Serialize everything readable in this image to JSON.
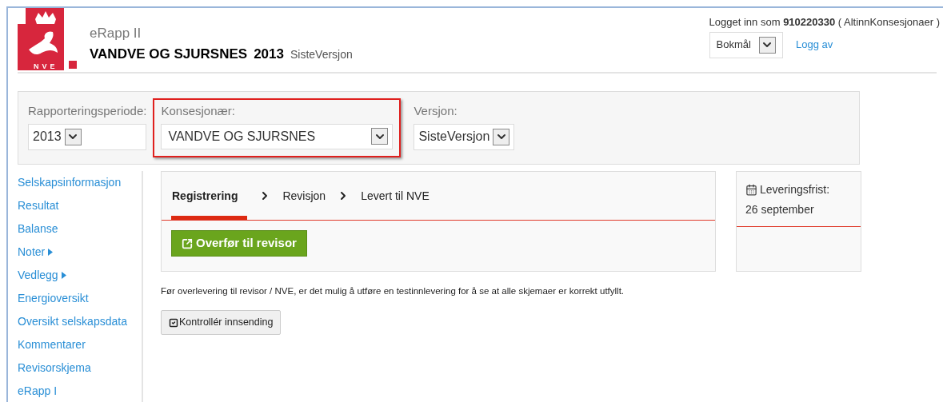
{
  "header": {
    "logo_text": "NVE",
    "app_name": "eRapp II",
    "company": "VANDVE OG SJURSNES",
    "year": "2013",
    "version": "SisteVersjon"
  },
  "user": {
    "prefix": "Logget inn som",
    "id": "910220330",
    "role": "( AltinnKonsesjonaer )",
    "language": "Bokmål",
    "logout": "Logg av"
  },
  "filters": [
    {
      "label": "Rapporteringsperiode:",
      "value": "2013",
      "highlighted": false
    },
    {
      "label": "Konsesjonær:",
      "value": "VANDVE OG SJURSNES",
      "highlighted": true
    },
    {
      "label": "Versjon:",
      "value": "SisteVersjon",
      "highlighted": false
    }
  ],
  "sidebar": {
    "items": [
      {
        "label": "Selskapsinformasjon",
        "expandable": false
      },
      {
        "label": "Resultat",
        "expandable": false
      },
      {
        "label": "Balanse",
        "expandable": false
      },
      {
        "label": "Noter",
        "expandable": true
      },
      {
        "label": "Vedlegg",
        "expandable": true
      },
      {
        "label": "Energioversikt",
        "expandable": false
      },
      {
        "label": "Oversikt selskapsdata",
        "expandable": false
      },
      {
        "label": "Kommentarer",
        "expandable": false
      },
      {
        "label": "Revisorskjema",
        "expandable": false
      },
      {
        "label": "eRapp I",
        "expandable": false
      }
    ]
  },
  "steps": [
    {
      "label": "Registrering",
      "selected": true
    },
    {
      "label": "Revisjon",
      "selected": false
    },
    {
      "label": "Levert til NVE",
      "selected": false
    }
  ],
  "transfer_button": "Overfør til revisor",
  "deadline": {
    "label": "Leveringsfrist:",
    "date": "26 september"
  },
  "info_text": "Før overlevering til revisor / NVE, er det mulig å utføre en testinnlevering for å se at alle skjemaer er korrekt utfyllt.",
  "check_button": "Kontrollér innsending"
}
